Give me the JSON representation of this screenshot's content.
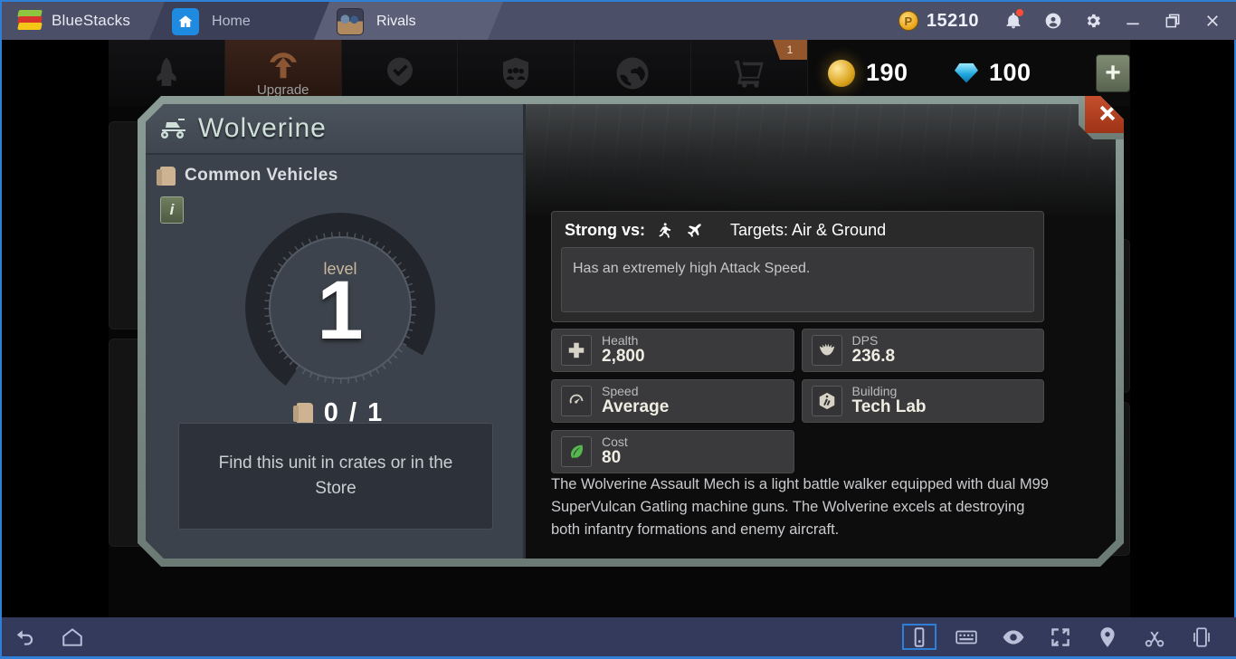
{
  "titlebar": {
    "brand": "BlueStacks",
    "brand_logo_icon": "bluestacks-logo",
    "tabs": [
      {
        "label": "Home",
        "icon": "home-icon"
      },
      {
        "label": "Rivals",
        "icon": "rivals-app-icon"
      }
    ],
    "points": "15210",
    "points_icon": "points-coin-icon",
    "controls": {
      "notifications_icon": "bell-icon",
      "account_icon": "account-avatar-icon",
      "settings_icon": "gear-icon",
      "minimize_icon": "minimize-icon",
      "restore_icon": "restore-icon",
      "close_icon": "close-icon"
    },
    "colors": {
      "bar": "#4b5068",
      "active_tab": "#5b6078",
      "accent_border": "#2f7fd6"
    }
  },
  "game_nav": {
    "tabs": [
      {
        "name": "army",
        "icon": "rocket-icon",
        "label": "",
        "active": false
      },
      {
        "name": "upgrade",
        "icon": "upgrade-arrow-icon",
        "label": "Upgrade",
        "active": true
      },
      {
        "name": "achievements",
        "icon": "medal-check-icon",
        "label": "",
        "active": false
      },
      {
        "name": "clan",
        "icon": "people-shield-icon",
        "label": "",
        "active": false
      },
      {
        "name": "world",
        "icon": "globe-icon",
        "label": "",
        "active": false
      },
      {
        "name": "store",
        "icon": "cart-icon",
        "label": "",
        "active": false,
        "badge": "1"
      }
    ],
    "resources": [
      {
        "name": "gold",
        "icon": "gold-coin-icon",
        "value": "190"
      },
      {
        "name": "gems",
        "icon": "diamond-icon",
        "value": "100"
      }
    ],
    "add_button_label": "+"
  },
  "unit": {
    "name": "Wolverine",
    "name_icon": "vehicle-icon",
    "rarity": "Common Vehicles",
    "rarity_icon": "card-icon",
    "info_button_label": "i",
    "level_label": "level",
    "level_value": "1",
    "cards_progress": "0 / 1",
    "find_hint": "Find this unit in crates or in the Store",
    "strong_vs_label": "Strong vs:",
    "strong_vs_icons": [
      "infantry-icon",
      "aircraft-icon"
    ],
    "targets": "Targets: Air & Ground",
    "ability_text": "Has an extremely high Attack Speed.",
    "stats": [
      {
        "key": "Health",
        "value": "2,800",
        "icon": "health-cross-icon"
      },
      {
        "key": "DPS",
        "value": "236.8",
        "icon": "damage-claw-icon"
      },
      {
        "key": "Speed",
        "value": "Average",
        "icon": "speedometer-icon"
      },
      {
        "key": "Building",
        "value": "Tech Lab",
        "icon": "tech-lab-icon"
      },
      {
        "key": "Cost",
        "value": "80",
        "icon": "leaf-cost-icon"
      }
    ],
    "description": "The Wolverine Assault Mech is a light battle walker equipped with dual M99 SuperVulcan Gatling machine guns. The Wolverine excels at destroying both infantry formations and enemy aircraft.",
    "close_icon": "close-x-icon"
  },
  "bottombar": {
    "left": [
      {
        "name": "back",
        "icon": "back-arrow-icon"
      },
      {
        "name": "home",
        "icon": "home-outline-icon"
      }
    ],
    "right": [
      {
        "name": "rotate",
        "icon": "rotate-screen-icon",
        "selected": true
      },
      {
        "name": "keyboard",
        "icon": "keyboard-icon"
      },
      {
        "name": "eye",
        "icon": "eye-icon"
      },
      {
        "name": "fullscreen",
        "icon": "fullscreen-icon"
      },
      {
        "name": "location",
        "icon": "location-pin-icon"
      },
      {
        "name": "screenshot",
        "icon": "scissors-icon"
      },
      {
        "name": "shake",
        "icon": "shake-phone-icon"
      }
    ]
  }
}
